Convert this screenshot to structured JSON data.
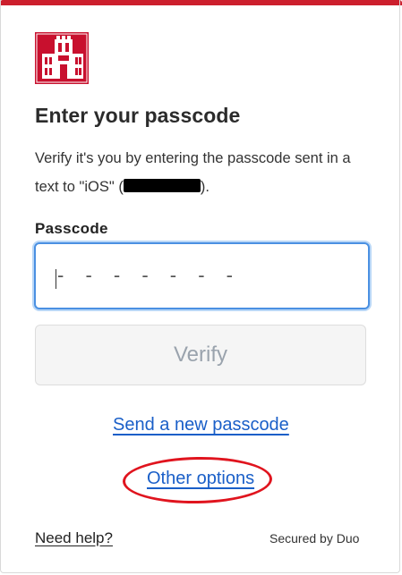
{
  "colors": {
    "brand": "#cc1f2d",
    "link": "#1a5fc8",
    "annotation": "#e0141e"
  },
  "header": {
    "logo_icon": "university-tower-logo-icon"
  },
  "main": {
    "title": "Enter your passcode",
    "description_prefix": "Verify it's you by entering the passcode sent in a text to \"iOS\" (",
    "description_suffix": ").",
    "passcode_label": "Passcode",
    "passcode_value": "",
    "passcode_placeholder": "- - - - - - -",
    "verify_label": "Verify",
    "send_new_label": "Send a new passcode",
    "other_options_label": "Other options"
  },
  "footer": {
    "help_label": "Need help?",
    "secured_label": "Secured by Duo"
  }
}
